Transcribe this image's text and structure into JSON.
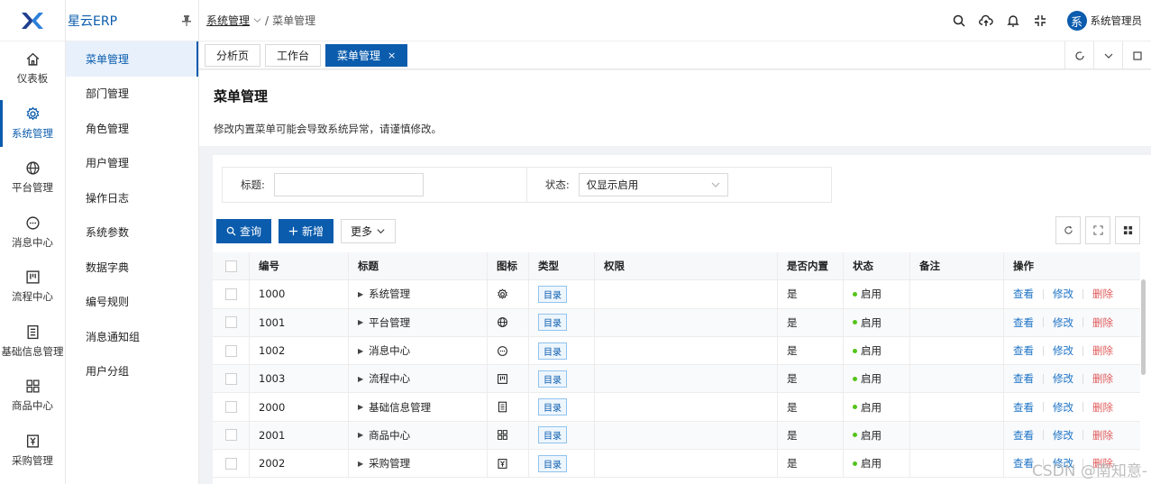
{
  "app": {
    "title": "星云ERP"
  },
  "rail": [
    {
      "label": "仪表板",
      "icon": "home-icon",
      "active": false
    },
    {
      "label": "系统管理",
      "icon": "gear-icon",
      "active": true
    },
    {
      "label": "平台管理",
      "icon": "globe-icon",
      "active": false
    },
    {
      "label": "消息中心",
      "icon": "chat-icon",
      "active": false
    },
    {
      "label": "流程中心",
      "icon": "kanban-icon",
      "active": false
    },
    {
      "label": "基础信息管理",
      "icon": "document-icon",
      "active": false
    },
    {
      "label": "商品中心",
      "icon": "grid-icon",
      "active": false
    },
    {
      "label": "采购管理",
      "icon": "purchase-icon",
      "active": false
    }
  ],
  "submenu": [
    "菜单管理",
    "部门管理",
    "角色管理",
    "用户管理",
    "操作日志",
    "系统参数",
    "数据字典",
    "编号规则",
    "消息通知组",
    "用户分组"
  ],
  "breadcrumb": {
    "parent": "系统管理",
    "current": "菜单管理"
  },
  "user": {
    "avatar": "系",
    "name": "系统管理员"
  },
  "tabs": [
    {
      "label": "分析页",
      "active": false
    },
    {
      "label": "工作台",
      "active": false
    },
    {
      "label": "菜单管理",
      "active": true,
      "close": "×"
    }
  ],
  "page": {
    "title": "菜单管理",
    "description": "修改内置菜单可能会导致系统异常，请谨慎修改。"
  },
  "filters": {
    "title_label": "标题:",
    "title_value": "",
    "status_label": "状态:",
    "status_value": "仅显示启用"
  },
  "buttons": {
    "query": "查询",
    "add": "新增",
    "more": "更多"
  },
  "table": {
    "headers": [
      "编号",
      "标题",
      "图标",
      "类型",
      "权限",
      "是否内置",
      "状态",
      "备注",
      "操作"
    ],
    "rows": [
      {
        "id": "1000",
        "title": "系统管理",
        "icon": "gear-icon",
        "type": "目录",
        "perm": "",
        "builtin": "是",
        "status": "启用",
        "remark": ""
      },
      {
        "id": "1001",
        "title": "平台管理",
        "icon": "globe-icon",
        "type": "目录",
        "perm": "",
        "builtin": "是",
        "status": "启用",
        "remark": ""
      },
      {
        "id": "1002",
        "title": "消息中心",
        "icon": "chat-icon",
        "type": "目录",
        "perm": "",
        "builtin": "是",
        "status": "启用",
        "remark": ""
      },
      {
        "id": "1003",
        "title": "流程中心",
        "icon": "kanban-icon",
        "type": "目录",
        "perm": "",
        "builtin": "是",
        "status": "启用",
        "remark": ""
      },
      {
        "id": "2000",
        "title": "基础信息管理",
        "icon": "document-icon",
        "type": "目录",
        "perm": "",
        "builtin": "是",
        "status": "启用",
        "remark": ""
      },
      {
        "id": "2001",
        "title": "商品中心",
        "icon": "grid-icon",
        "type": "目录",
        "perm": "",
        "builtin": "是",
        "status": "启用",
        "remark": ""
      },
      {
        "id": "2002",
        "title": "采购管理",
        "icon": "purchase-icon",
        "type": "目录",
        "perm": "",
        "builtin": "是",
        "status": "启用",
        "remark": ""
      }
    ],
    "actions": {
      "view": "查看",
      "edit": "修改",
      "delete": "删除"
    }
  },
  "watermark": "CSDN @南知意-",
  "colors": {
    "primary": "#0b5cad",
    "danger": "#e05a5a",
    "success": "#52c41a"
  }
}
